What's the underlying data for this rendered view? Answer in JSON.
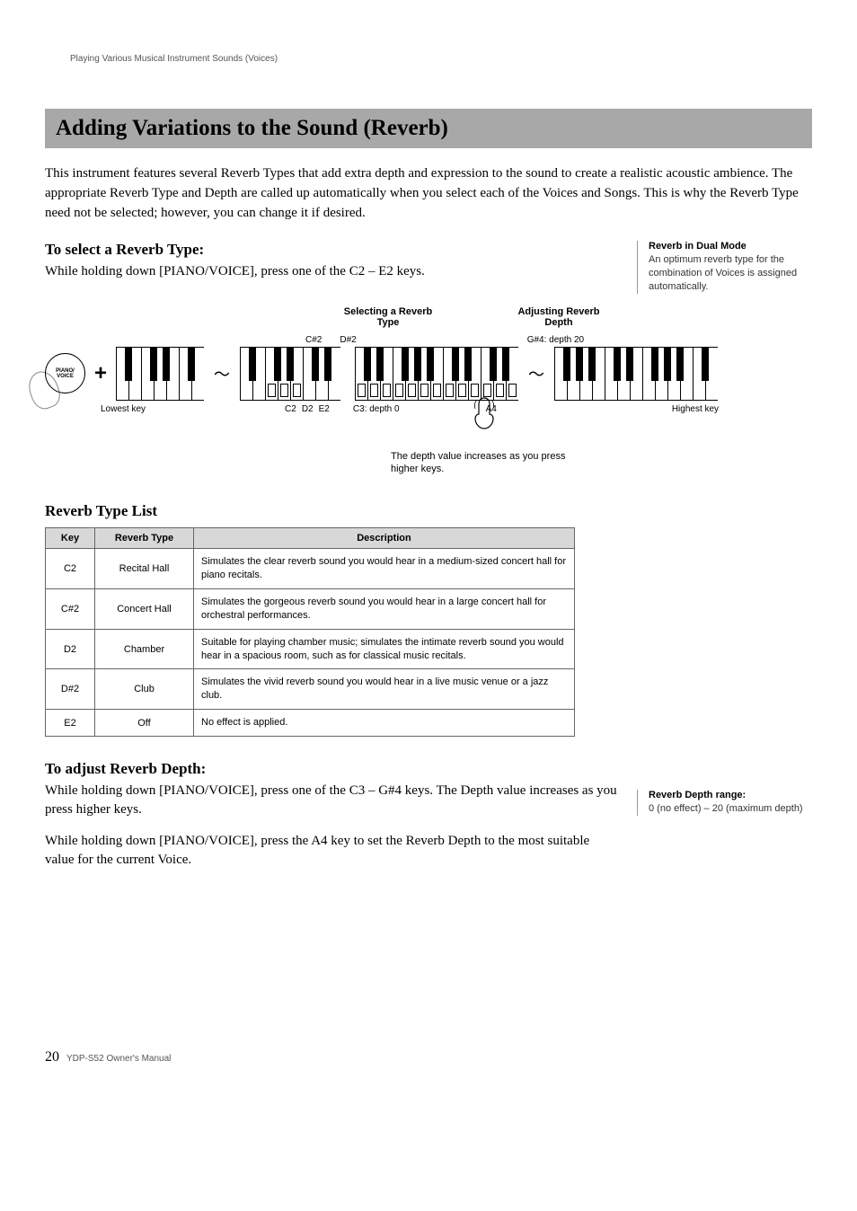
{
  "breadcrumb": "Playing Various Musical Instrument Sounds (Voices)",
  "section_title": "Adding Variations to the Sound (Reverb)",
  "intro": "This instrument features several Reverb Types that add extra depth and expression to the sound to create a realistic acoustic ambience. The appropriate Reverb Type and Depth are called up automatically when you select each of the Voices and Songs. This is why the Reverb Type need not be selected; however, you can change it if desired.",
  "select_heading": "To select a Reverb Type:",
  "select_body": "While holding down [PIANO/VOICE], press one of the C2 – E2 keys.",
  "side_note1_title": "Reverb in Dual Mode",
  "side_note1_body": "An optimum reverb type for the combination of Voices is assigned automatically.",
  "diagram": {
    "label_left": "Selecting a Reverb Type",
    "label_right": "Adjusting Reverb Depth",
    "sharp_left1": "C#2",
    "sharp_left2": "D#2",
    "sharp_right": "G#4: depth 20",
    "piano_voice_label": "PIANO/\nVOICE",
    "lowest": "Lowest key",
    "c2": "C2",
    "d2": "D2",
    "e2": "E2",
    "c3": "C3: depth 0",
    "a4": "A4",
    "highest": "Highest key",
    "caption": "The depth value increases as you press higher keys."
  },
  "list_heading": "Reverb Type List",
  "table": {
    "headers": [
      "Key",
      "Reverb Type",
      "Description"
    ],
    "rows": [
      {
        "key": "C2",
        "type": "Recital Hall",
        "desc": "Simulates the clear reverb sound you would hear in a medium-sized concert hall for piano recitals."
      },
      {
        "key": "C#2",
        "type": "Concert Hall",
        "desc": "Simulates the gorgeous reverb sound you would hear in a large concert hall for orchestral performances."
      },
      {
        "key": "D2",
        "type": "Chamber",
        "desc": "Suitable for playing chamber music; simulates the intimate reverb sound you would hear in a spacious room, such as for classical music recitals."
      },
      {
        "key": "D#2",
        "type": "Club",
        "desc": "Simulates the vivid reverb sound you would hear in a live music venue or a jazz club."
      },
      {
        "key": "E2",
        "type": "Off",
        "desc": "No effect is applied."
      }
    ]
  },
  "adjust_heading": "To adjust Reverb Depth:",
  "adjust_body1": "While holding down [PIANO/VOICE], press one of the C3 – G#4 keys. The Depth value increases as you press higher keys.",
  "adjust_body2": "While holding down [PIANO/VOICE], press the A4 key to set the Reverb Depth to the most suitable value for the current Voice.",
  "side_note2_title": "Reverb Depth range:",
  "side_note2_body": "0 (no effect) – 20 (maximum depth)",
  "page_number": "20",
  "footer_text": "YDP-S52 Owner's Manual"
}
